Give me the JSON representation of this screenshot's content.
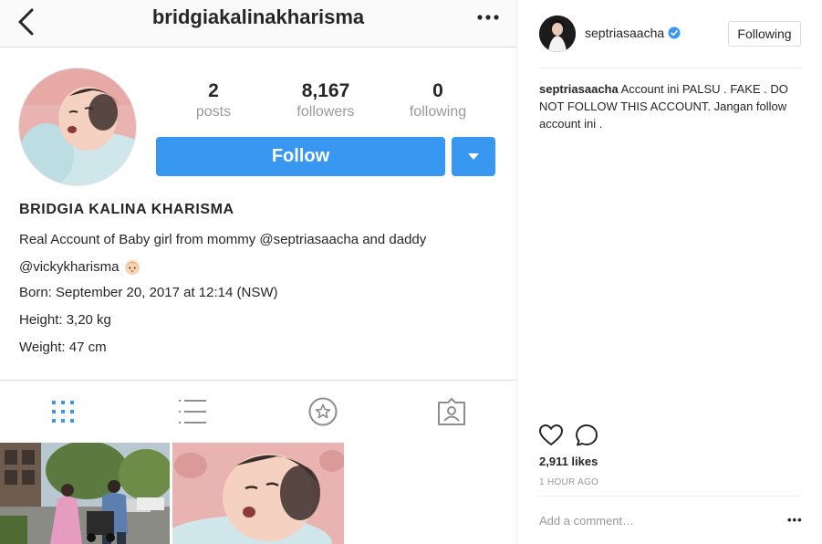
{
  "profile": {
    "username": "bridgiakalinakharisma",
    "stats": [
      {
        "value": "2",
        "label": "posts"
      },
      {
        "value": "8,167",
        "label": "followers"
      },
      {
        "value": "0",
        "label": "following"
      }
    ],
    "follow_label": "Follow",
    "full_name": "BRIDGIA KALINA KHARISMA",
    "bio": [
      "Real Account of Baby girl from mommy @septriasaacha and daddy",
      "@vickykharisma",
      "Born: September 20, 2017 at 12:14 (NSW)",
      "Height: 3,20 kg",
      "Weight: 47 cm"
    ]
  },
  "post": {
    "author": "septriasaacha",
    "following_label": "Following",
    "caption_user": "septriasaacha",
    "caption_text": " Account ini PALSU . FAKE . DO NOT FOLLOW THIS ACCOUNT. Jangan follow account ini .",
    "likes": "2,911 likes",
    "time_ago": "1 HOUR AGO",
    "comment_placeholder": "Add a comment…",
    "more": "•••"
  },
  "colors": {
    "accent_blue": "#3897f0",
    "verified_blue": "#3897f0",
    "muted_text": "#999999",
    "divider": "#dbdbdb"
  },
  "icons": [
    "back-arrow-icon",
    "more-dots-icon",
    "dropdown-arrow-icon",
    "grid-icon",
    "list-icon",
    "saved-star-icon",
    "tagged-icon",
    "verified-icon",
    "heart-icon",
    "comment-icon",
    "baby-emoji-icon"
  ]
}
